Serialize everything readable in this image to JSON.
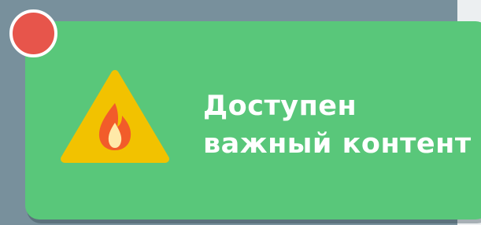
{
  "banner": {
    "line1": "Доступен",
    "line2": "важный контент",
    "background_color": "#59c77a",
    "text_color": "#ffffff"
  },
  "icon": {
    "name": "warning-fire-icon",
    "triangle_color": "#f2c200",
    "flame_color": "#f25c2a"
  },
  "close_dot": {
    "name": "close-dot-icon",
    "color": "#e7554b"
  },
  "backdrop": {
    "color": "#78909c"
  }
}
